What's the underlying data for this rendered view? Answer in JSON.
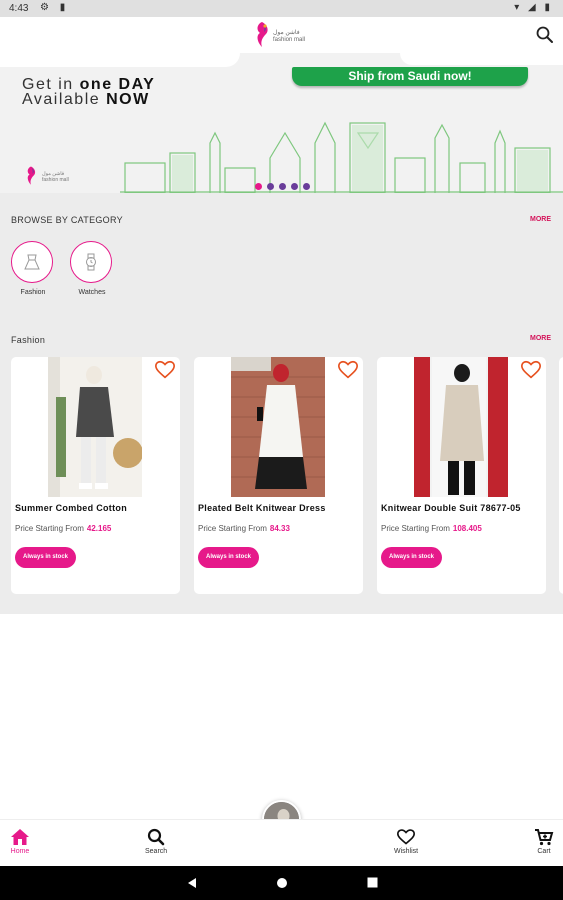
{
  "status_bar": {
    "time": "4:43",
    "left_icons": "⚙ ▮",
    "right_icons": "▾ ◢ ▮"
  },
  "header": {
    "logo_text_ar": "فاشن مول",
    "logo_text_en": "fashion mall"
  },
  "banner": {
    "line1_prefix": "Get in ",
    "line1_bold": "one DAY",
    "line2_prefix": "Available ",
    "line2_bold": "NOW",
    "ship_badge": "Ship from Saudi now!",
    "slides": 5,
    "active_slide": 0
  },
  "browse": {
    "title": "BROWSE BY CATEGORY",
    "more": "MORE",
    "categories": [
      {
        "label": "Fashion",
        "icon": "dress-icon"
      },
      {
        "label": "Watches",
        "icon": "watch-icon"
      }
    ]
  },
  "fashion": {
    "title": "Fashion",
    "more": "MORE",
    "products": [
      {
        "name": "Summer Combed Cotton",
        "price_prefix": "Price Starting From",
        "price": "42.165",
        "stock": "Always in stock"
      },
      {
        "name": "Pleated Belt Knitwear Dress",
        "price_prefix": "Price Starting From",
        "price": "84.33",
        "stock": "Always in stock"
      },
      {
        "name": "Knitwear Double Suit 78677-05",
        "price_prefix": "Price Starting From",
        "price": "108.405",
        "stock": "Always in stock"
      }
    ]
  },
  "bottom_nav": {
    "items": [
      {
        "label": "Home",
        "icon": "home-icon",
        "active": true
      },
      {
        "label": "Search",
        "icon": "search-icon",
        "active": false
      },
      {
        "label": "Wishlist",
        "icon": "heart-icon",
        "active": false
      },
      {
        "label": "Cart",
        "icon": "cart-icon",
        "active": false
      }
    ]
  },
  "colors": {
    "accent": "#e6198a",
    "more": "#d4145a",
    "ship_green": "#1ea24a",
    "dot_inactive": "#6a3d9a"
  }
}
